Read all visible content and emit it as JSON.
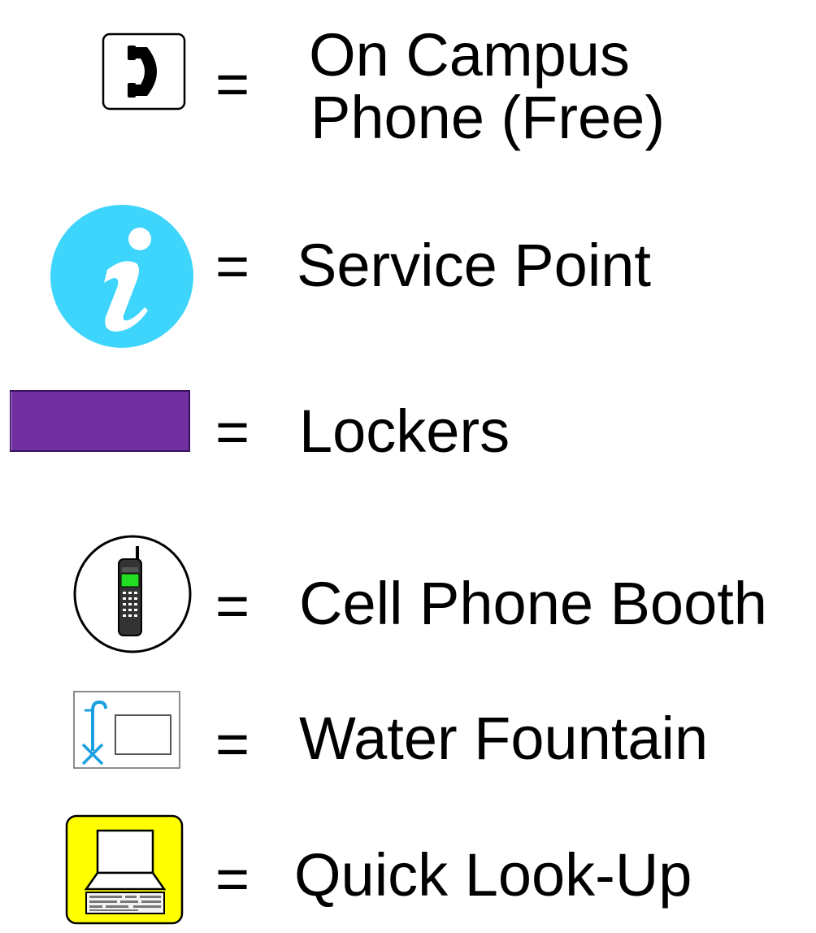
{
  "legend": {
    "items": [
      {
        "icon": "on-campus-phone-icon",
        "equals": "=",
        "label_line1": "On Campus",
        "label_line2": "Phone (Free)"
      },
      {
        "icon": "service-point-info-icon",
        "equals": "=",
        "label": "Service Point"
      },
      {
        "icon": "lockers-swatch-icon",
        "equals": "=",
        "label": "Lockers"
      },
      {
        "icon": "cell-phone-booth-icon",
        "equals": "=",
        "label": "Cell Phone Booth"
      },
      {
        "icon": "water-fountain-icon",
        "equals": "=",
        "label": "Water Fountain"
      },
      {
        "icon": "quick-look-up-computer-icon",
        "equals": "=",
        "label": "Quick Look-Up"
      }
    ]
  },
  "colors": {
    "service_point": "#3dd5fb",
    "lockers": "#7030a0",
    "water_fountain": "#1aa0e0",
    "quick_look_up_bg": "#ffff00",
    "cell_phone_screen": "#22dd22"
  }
}
